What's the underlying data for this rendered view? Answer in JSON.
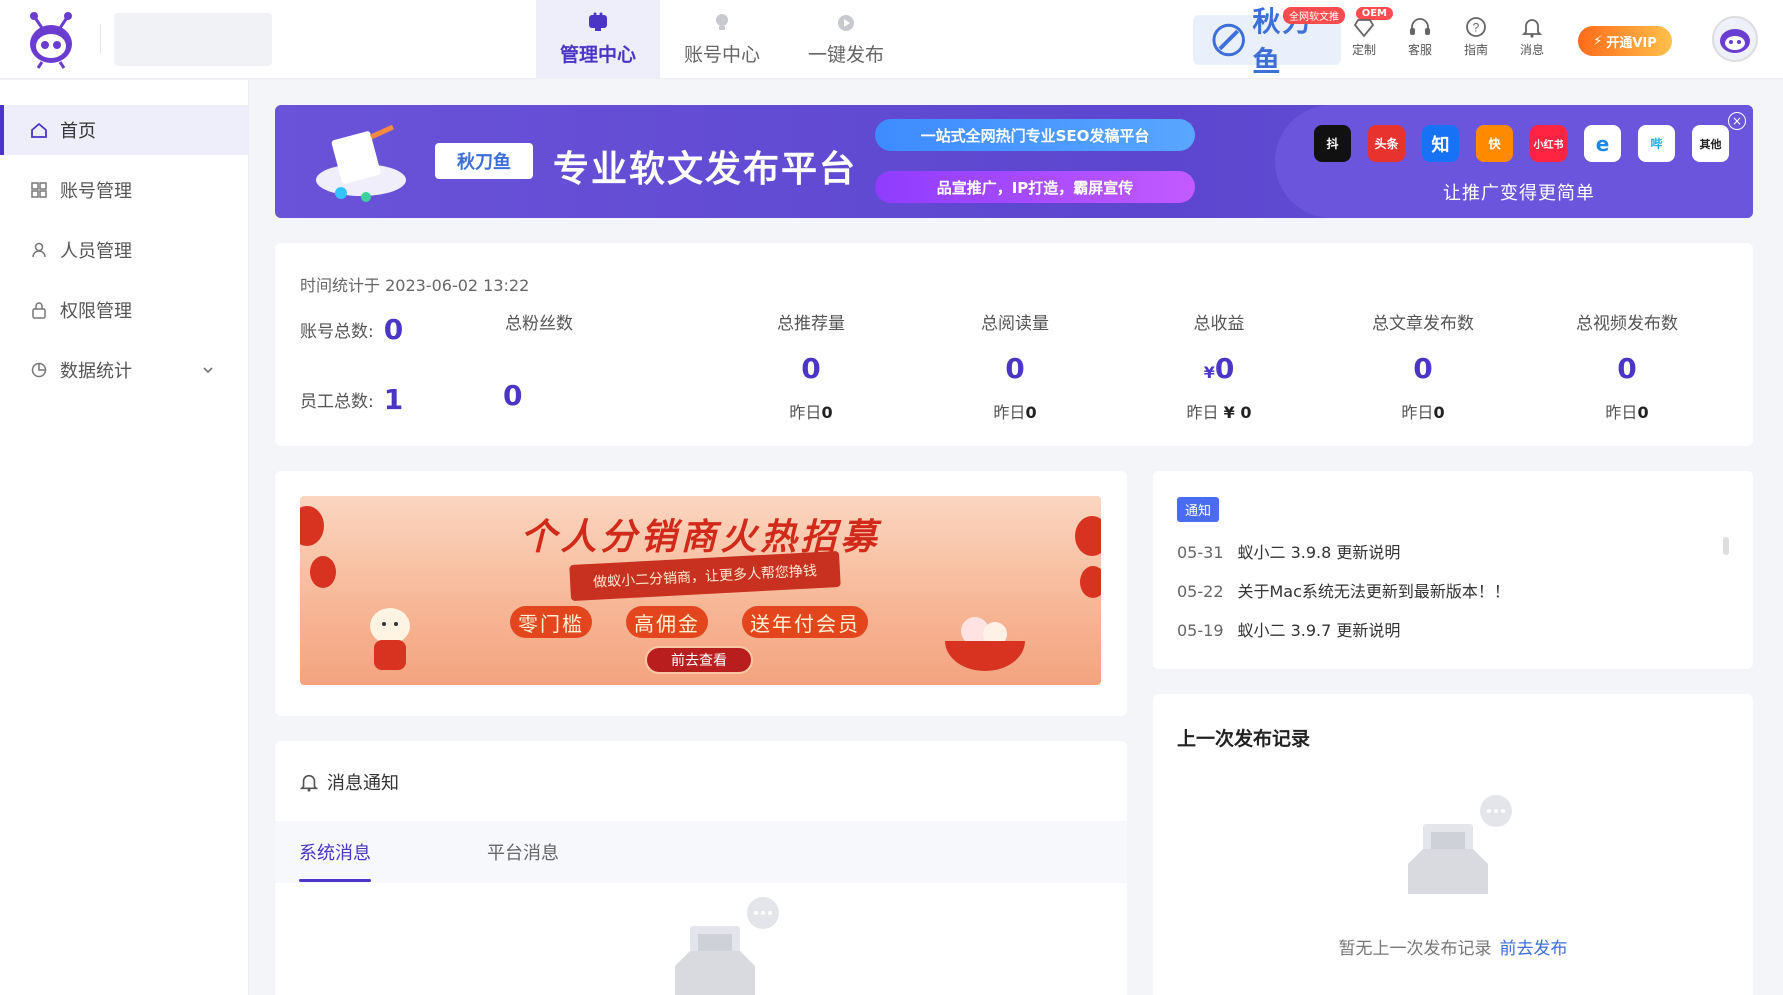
{
  "topnav": [
    {
      "label": "管理中心",
      "active": true
    },
    {
      "label": "账号中心",
      "active": false
    },
    {
      "label": "一键发布",
      "active": false
    }
  ],
  "brand": {
    "name": "秋刀鱼",
    "tag": "全网软文推",
    "oem": "OEM"
  },
  "tools": [
    {
      "label": "定制",
      "icon": "diamond-icon"
    },
    {
      "label": "客服",
      "icon": "headset-icon"
    },
    {
      "label": "指南",
      "icon": "help-icon"
    },
    {
      "label": "消息",
      "icon": "bell-icon"
    }
  ],
  "vip": "开通VIP",
  "sidebar": {
    "items": [
      {
        "label": "首页",
        "icon": "home-icon",
        "active": true
      },
      {
        "label": "账号管理",
        "icon": "grid-icon"
      },
      {
        "label": "人员管理",
        "icon": "user-icon"
      },
      {
        "label": "权限管理",
        "icon": "lock-icon"
      },
      {
        "label": "数据统计",
        "icon": "pie-icon"
      }
    ]
  },
  "banner": {
    "logo_text": "秋刀鱼",
    "headline": "专业软文发布平台",
    "line1": "一站式全网热门专业SEO发稿平台",
    "line2": "品宣推广，IP打造，霸屏宣传",
    "platforms": [
      "抖",
      "头条",
      "知",
      "快",
      "小红书",
      "e",
      "哔",
      "其他"
    ],
    "slogan": "让推广变得更简单",
    "close": "×"
  },
  "stats": {
    "timestamp": "时间统计于 2023-06-02 13:22",
    "accounts_label": "账号总数:",
    "accounts_value": "0",
    "staff_label": "员工总数:",
    "staff_value": "1",
    "fans_label": "总粉丝数",
    "fans_value": "0",
    "columns": [
      {
        "label": "总推荐量",
        "value": "0",
        "yesterday_label": "昨日",
        "yesterday_value": "0"
      },
      {
        "label": "总阅读量",
        "value": "0",
        "yesterday_label": "昨日",
        "yesterday_value": "0"
      },
      {
        "label": "总收益",
        "currency": "¥",
        "value": "0",
        "yesterday_label": "昨日 ",
        "yesterday_value": "¥ 0"
      },
      {
        "label": "总文章发布数",
        "value": "0",
        "yesterday_label": "昨日",
        "yesterday_value": "0"
      },
      {
        "label": "总视频发布数",
        "value": "0",
        "yesterday_label": "昨日",
        "yesterday_value": "0"
      }
    ]
  },
  "promo": {
    "title": "个人分销商火热招募",
    "ribbon": "做蚁小二分销商，让更多人帮您挣钱",
    "perks": [
      "零门槛",
      "高佣金",
      "送年付会员"
    ],
    "button": "前去查看"
  },
  "notice": {
    "tag": "通知",
    "items": [
      {
        "date": "05-31",
        "text": "蚁小二 3.9.8 更新说明"
      },
      {
        "date": "05-22",
        "text": "关于Mac系统无法更新到最新版本！！"
      },
      {
        "date": "05-19",
        "text": "蚁小二 3.9.7 更新说明"
      }
    ]
  },
  "last_publish": {
    "title": "上一次发布记录",
    "empty_text": "暂无上一次发布记录",
    "link": "前去发布"
  },
  "messages": {
    "title": "消息通知",
    "tabs": [
      {
        "label": "系统消息",
        "active": true
      },
      {
        "label": "平台消息",
        "active": false
      }
    ]
  },
  "colors": {
    "accent": "#4a35c6",
    "link": "#3c6fd8",
    "banner": "#5c46cf"
  }
}
